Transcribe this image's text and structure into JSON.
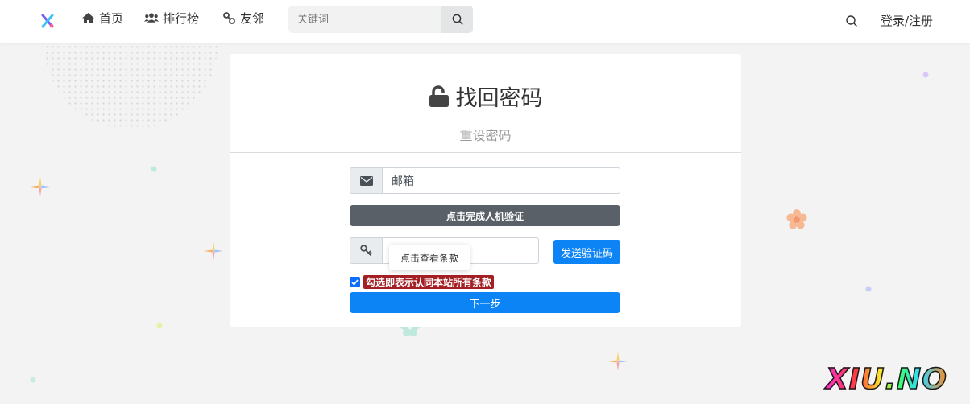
{
  "header": {
    "nav": [
      {
        "label": "首页",
        "icon": "home-icon"
      },
      {
        "label": "排行榜",
        "icon": "users-icon"
      },
      {
        "label": "友邻",
        "icon": "link-icon"
      }
    ],
    "search_placeholder": "关键词",
    "login_label": "登录/注册"
  },
  "card": {
    "title": "找回密码",
    "subtitle": "重设密码",
    "email_placeholder": "邮箱",
    "captcha_label": "点击完成人机验证",
    "send_code_label": "发送验证码",
    "tooltip_text": "点击查看条款",
    "terms_label": "勾选即表示认同本站所有条款",
    "terms_checked": true,
    "next_label": "下一步"
  },
  "watermark": "XIU.NO",
  "colors": {
    "primary": "#0d84f5",
    "captcha": "#5a6068",
    "terms": "#a31f24"
  }
}
